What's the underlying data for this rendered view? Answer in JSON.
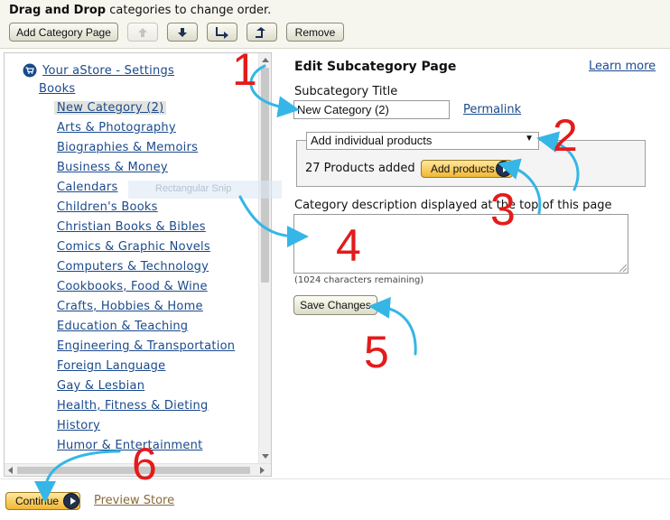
{
  "instruction": {
    "bold": "Drag and Drop",
    "rest": " categories to change order."
  },
  "toolbar": {
    "add_category_label": "Add Category Page",
    "remove_label": "Remove"
  },
  "tree": {
    "root": "Your aStore - Settings",
    "parent": "Books",
    "items": [
      "New Category (2)",
      "Arts & Photography",
      "Biographies & Memoirs",
      "Business & Money",
      "Calendars",
      "Children's Books",
      "Christian Books & Bibles",
      "Comics & Graphic Novels",
      "Computers & Technology",
      "Cookbooks, Food & Wine",
      "Crafts, Hobbies & Home",
      "Education & Teaching",
      "Engineering & Transportation",
      "Foreign Language",
      "Gay & Lesbian",
      "Health, Fitness & Dieting",
      "History",
      "Humor & Entertainment"
    ],
    "drag_ghost": "Rectangular Snip"
  },
  "panel": {
    "title": "Edit Subcategory Page",
    "learn_more": "Learn more",
    "subcat_title_label": "Subcategory Title",
    "subcat_title_value": "New Category (2)",
    "permalink": "Permalink",
    "product_mode": "Add individual products",
    "products_added": "27 Products added",
    "add_products_label": "Add products",
    "desc_label": "Category description displayed at the top of this page",
    "chars_remaining": "(1024 characters remaining)",
    "save_label": "Save Changes"
  },
  "footer": {
    "continue_label": "Continue",
    "preview_label": "Preview Store"
  },
  "annotations": {
    "step_numbers": [
      "1",
      "2",
      "3",
      "4",
      "5",
      "6"
    ],
    "number_color": "#e31b1b",
    "arrow_color": "#35b6e6"
  },
  "colors": {
    "link": "#1a4a8c",
    "gold_button": "#f1b733",
    "toolbar_bg": "#f6f6ee"
  }
}
